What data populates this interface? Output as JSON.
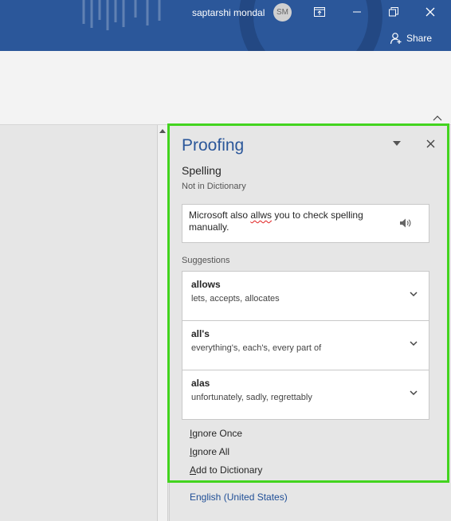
{
  "titlebar": {
    "user_name": "saptarshi mondal",
    "avatar_initials": "SM",
    "share_label": "Share",
    "color": "#2b579a"
  },
  "pane": {
    "title": "Proofing",
    "heading": "Spelling",
    "subheading": "Not in Dictionary",
    "sentence": {
      "before": "Microsoft also ",
      "error_word": "allws",
      "after": " you to check spelling manually."
    },
    "suggestions_label": "Suggestions",
    "suggestions": [
      {
        "word": "allows",
        "synonyms": "lets, accepts, allocates"
      },
      {
        "word": "all's",
        "synonyms": "everything's, each's, every part of"
      },
      {
        "word": "alas",
        "synonyms": "unfortunately, sadly, regrettably"
      }
    ],
    "actions": {
      "ignore_once_key": "I",
      "ignore_once_rest": "gnore Once",
      "ignore_all_key": "I",
      "ignore_all_rest": "gnore All",
      "add_key": "A",
      "add_rest": "dd to Dictionary"
    },
    "language": "English (United States)"
  },
  "colors": {
    "accent": "#2b579a",
    "highlight": "#43d41f",
    "error": "#e02020"
  }
}
